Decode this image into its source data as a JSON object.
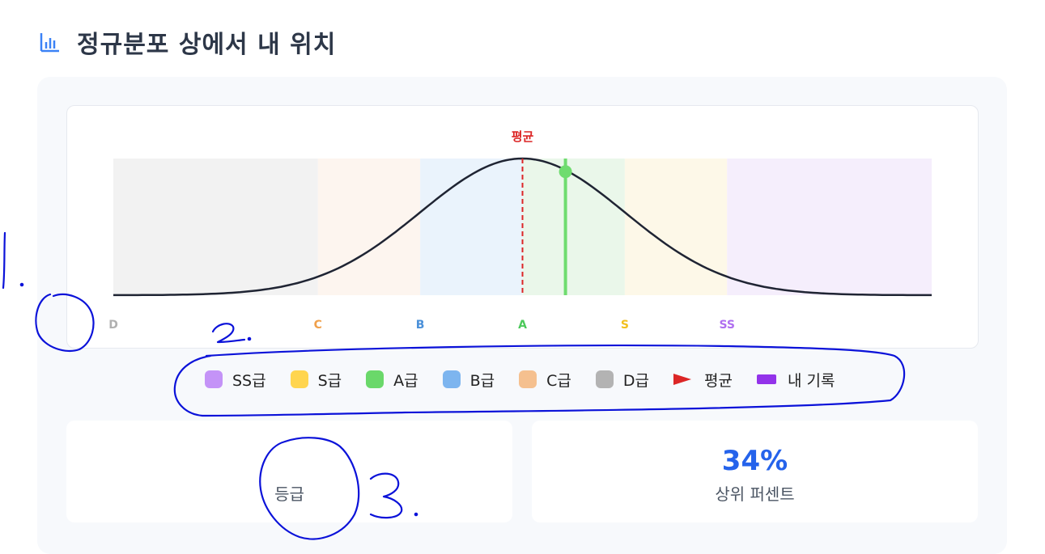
{
  "header": {
    "icon": "bar-chart-icon",
    "title": "정규분포 상에서 내 위치"
  },
  "chart_data": {
    "type": "area",
    "title": "",
    "mean_label": "평균",
    "curve": "normal distribution",
    "x_domain": [
      -4,
      4
    ],
    "mean": 0,
    "my_record_z": 0.42,
    "grade_bands": [
      {
        "grade": "D",
        "label": "D",
        "from": -4,
        "to": -2,
        "fill": "#f2f2f2",
        "text": "#b0b0b0"
      },
      {
        "grade": "C",
        "label": "C",
        "from": -2,
        "to": -1,
        "fill": "#fdf5ef",
        "text": "#f0a04b"
      },
      {
        "grade": "B",
        "label": "B",
        "from": -1,
        "to": 0,
        "fill": "#eaf3fc",
        "text": "#4a90d9"
      },
      {
        "grade": "A",
        "label": "A",
        "from": 0,
        "to": 1,
        "fill": "#eaf7ea",
        "text": "#4cc95b"
      },
      {
        "grade": "S",
        "label": "S",
        "from": 1,
        "to": 2,
        "fill": "#fdf8e8",
        "text": "#f2c01e"
      },
      {
        "grade": "SS",
        "label": "SS",
        "from": 2,
        "to": 4,
        "fill": "#f5eefc",
        "text": "#b070f0"
      }
    ],
    "colors": {
      "curve": "#1f2433",
      "mean_line": "#dc2626",
      "my_record": "#6fdc6f"
    }
  },
  "legend": [
    {
      "label": "SS급",
      "color": "#c493f7",
      "shape": "square"
    },
    {
      "label": "S급",
      "color": "#ffd54f",
      "shape": "square"
    },
    {
      "label": "A급",
      "color": "#6ad86a",
      "shape": "square"
    },
    {
      "label": "B급",
      "color": "#7db5ef",
      "shape": "square"
    },
    {
      "label": "C급",
      "color": "#f5c08f",
      "shape": "square"
    },
    {
      "label": "D급",
      "color": "#b3b3b3",
      "shape": "square"
    },
    {
      "label": "평균",
      "color": "#dc2626",
      "shape": "triangle"
    },
    {
      "label": "내 기록",
      "color": "#9333ea",
      "shape": "rect"
    }
  ],
  "cards": {
    "grade": {
      "value": "",
      "label": "등급"
    },
    "percent": {
      "value": "34%",
      "label": "상위 퍼센트",
      "color": "#2563eb"
    }
  },
  "annotations": {
    "color": "#0b12d9",
    "marks": [
      "1.",
      "2.",
      "3."
    ]
  }
}
